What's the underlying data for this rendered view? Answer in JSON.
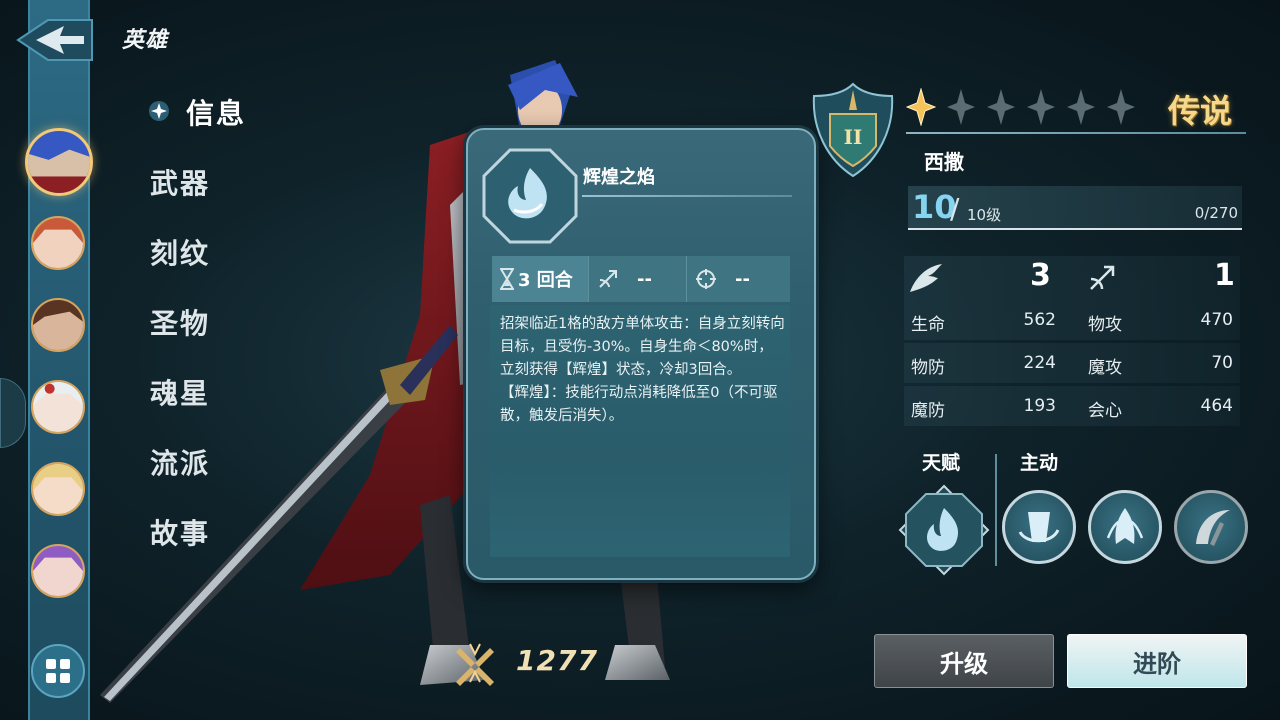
{
  "header": {
    "title": "英雄",
    "back_icon": "back-arrow-icon"
  },
  "nav": {
    "items": [
      {
        "label": "信息",
        "active": true
      },
      {
        "label": "武器"
      },
      {
        "label": "刻纹"
      },
      {
        "label": "圣物"
      },
      {
        "label": "魂星"
      },
      {
        "label": "流派"
      },
      {
        "label": "故事"
      }
    ]
  },
  "roster": {
    "portraits": [
      "blue-hair-knight",
      "red-hair-girl",
      "brown-hair-man",
      "white-hair-girl",
      "blonde-girl",
      "purple-hair-girl"
    ],
    "menu_icon": "grid-menu-icon"
  },
  "skill_popup": {
    "name": "辉煌之焰",
    "cooldown": "3 回合",
    "range": "--",
    "target": "--",
    "description": "招架临近1格的敌方单体攻击：自身立刻转向目标，且受伤-30%。自身生命＜80%时，立刻获得【辉煌】状态，冷却3回合。\n【辉煌】：技能行动点消耗降低至0（不可驱散，触发后消失）。"
  },
  "hero": {
    "rank": "II",
    "stars_filled": 1,
    "stars_total": 6,
    "rarity": "传说",
    "name": "西撒",
    "level": "10",
    "level_slash": "/",
    "level_max": "10级",
    "exp": "0/270",
    "move": "3",
    "attack_range": "1",
    "stats": [
      {
        "label": "生命",
        "value": "562"
      },
      {
        "label": "物攻",
        "value": "470"
      },
      {
        "label": "物防",
        "value": "224"
      },
      {
        "label": "魔攻",
        "value": "70"
      },
      {
        "label": "魔防",
        "value": "193"
      },
      {
        "label": "会心",
        "value": "464"
      }
    ]
  },
  "skills": {
    "talent_label": "天赋",
    "active_label": "主动"
  },
  "footer": {
    "power": "1277",
    "upgrade_label": "升级",
    "advance_label": "进阶"
  },
  "colors": {
    "accent": "#86d5f0",
    "gold": "#f6d88a",
    "panel": "#2f5f6e"
  }
}
